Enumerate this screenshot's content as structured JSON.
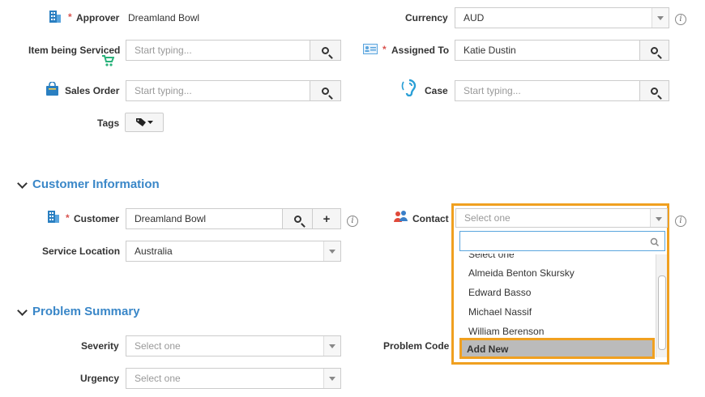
{
  "top": {
    "approver": {
      "label": "Approver",
      "value": "Dreamland Bowl"
    },
    "currency": {
      "label": "Currency",
      "value": "AUD"
    },
    "item_serviced": {
      "label": "Item being Serviced",
      "placeholder": "Start typing..."
    },
    "assigned_to": {
      "label": "Assigned To",
      "value": "Katie Dustin"
    },
    "sales_order": {
      "label": "Sales Order",
      "placeholder": "Start typing..."
    },
    "case": {
      "label": "Case",
      "placeholder": "Start typing..."
    },
    "tags": {
      "label": "Tags"
    }
  },
  "customer_section": {
    "title": "Customer Information",
    "customer": {
      "label": "Customer",
      "value": "Dreamland Bowl"
    },
    "contact": {
      "label": "Contact",
      "placeholder": "Select one"
    },
    "service_location": {
      "label": "Service Location",
      "value": "Australia"
    }
  },
  "contact_dropdown": {
    "partial_item": "Select one",
    "items": [
      "Almeida Benton Skursky",
      "Edward Basso",
      "Michael Nassif",
      "William Berenson"
    ],
    "add_new": "Add New"
  },
  "problem_section": {
    "title": "Problem Summary",
    "severity": {
      "label": "Severity",
      "placeholder": "Select one"
    },
    "urgency": {
      "label": "Urgency",
      "placeholder": "Select one"
    },
    "problem_code": {
      "label": "Problem Code"
    }
  },
  "colors": {
    "accent": "#3a87c8",
    "highlight": "#f0a020",
    "required": "#d9534f"
  }
}
